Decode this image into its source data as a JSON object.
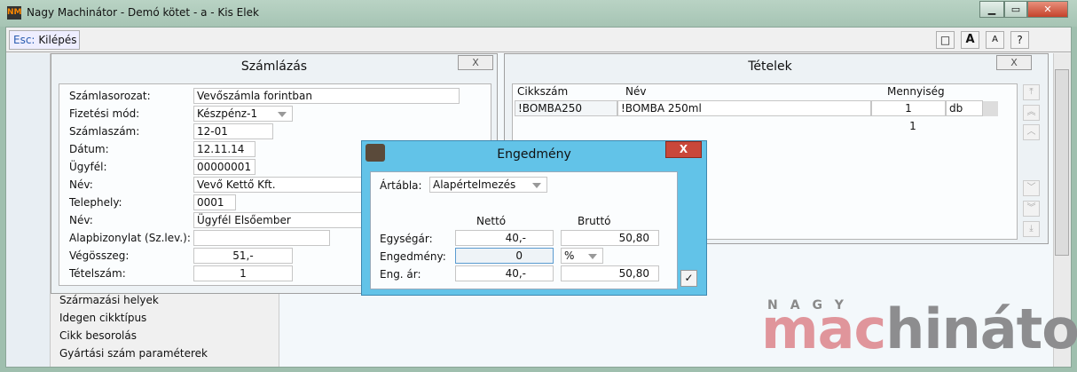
{
  "window": {
    "title": "Nagy Machinátor - Demó kötet - a - Kis Elek",
    "app_icon": "NM"
  },
  "toolbar": {
    "esc_key": "Esc:",
    "esc_label": "Kilépés",
    "buttons": [
      "□",
      "A",
      "A",
      "?"
    ]
  },
  "billing": {
    "title": "Számlázás",
    "close": "X",
    "fields": [
      {
        "label": "Számlasorozat:",
        "value": "Vevőszámla forintban"
      },
      {
        "label": "Fizetési mód:",
        "value": "Készpénz-1"
      },
      {
        "label": "Számlaszám:",
        "value": "12-01"
      },
      {
        "label": "Dátum:",
        "value": "12.11.14"
      },
      {
        "label": "Ügyfél:",
        "value": "00000001"
      },
      {
        "label": "Név:",
        "value": "Vevő Kettő Kft."
      },
      {
        "label": "Telephely:",
        "value": "0001"
      },
      {
        "label": "Név:",
        "value": "Ügyfél Elsőember"
      },
      {
        "label": "Alapbizonylat (Sz.lev.):",
        "value": ""
      },
      {
        "label": "Végösszeg:",
        "value": "51,-"
      },
      {
        "label": "Tételszám:",
        "value": "1"
      }
    ]
  },
  "menu_list": [
    "Származási helyek",
    "Idegen cikktípus",
    "Cikk besorolás",
    "Gyártási szám paraméterek"
  ],
  "items": {
    "title": "Tételek",
    "close": "X",
    "columns": [
      "Cikkszám",
      "Név",
      "Mennyiség"
    ],
    "rows": [
      {
        "code": "!BOMBA250",
        "name": "!BOMBA 250ml",
        "qty": "1",
        "unit": "db"
      }
    ],
    "total_qty": "1"
  },
  "discount": {
    "title": "Engedmény",
    "close": "X",
    "pricelist_label": "Ártábla:",
    "pricelist_value": "Alapértelmezés",
    "col_net": "Nettó",
    "col_gross": "Bruttó",
    "rows": [
      {
        "label": "Egységár:",
        "net": "40,-",
        "gross": "50,80"
      },
      {
        "label": "Engedmény:",
        "net": "0",
        "unit": "%"
      },
      {
        "label": "Eng. ár:",
        "net": "40,-",
        "gross": "50,80"
      }
    ],
    "ok": "✓"
  },
  "logo": {
    "top": "NAGY",
    "part1": "mac",
    "part2": "hinátor",
    "color1": "#e0959b",
    "color2": "#8d8d8f"
  }
}
